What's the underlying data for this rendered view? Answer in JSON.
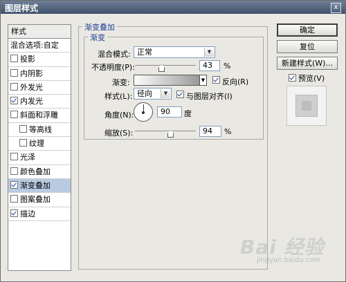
{
  "window": {
    "title": "图层样式",
    "close_glyph": "x"
  },
  "left_list": {
    "header": "样式",
    "items": [
      {
        "label": "混合选项:自定",
        "checkbox": null,
        "selected": false,
        "sub": false
      },
      {
        "label": "投影",
        "checkbox": false,
        "selected": false,
        "sub": false
      },
      {
        "label": "内阴影",
        "checkbox": false,
        "selected": false,
        "sub": false
      },
      {
        "label": "外发光",
        "checkbox": false,
        "selected": false,
        "sub": false
      },
      {
        "label": "内发光",
        "checkbox": true,
        "selected": false,
        "sub": false
      },
      {
        "label": "斜面和浮雕",
        "checkbox": false,
        "selected": false,
        "sub": false
      },
      {
        "label": "等高线",
        "checkbox": false,
        "selected": false,
        "sub": true
      },
      {
        "label": "纹理",
        "checkbox": false,
        "selected": false,
        "sub": true
      },
      {
        "label": "光泽",
        "checkbox": false,
        "selected": false,
        "sub": false
      },
      {
        "label": "颜色叠加",
        "checkbox": false,
        "selected": false,
        "sub": false
      },
      {
        "label": "渐变叠加",
        "checkbox": true,
        "selected": true,
        "sub": false
      },
      {
        "label": "图案叠加",
        "checkbox": false,
        "selected": false,
        "sub": false
      },
      {
        "label": "描边",
        "checkbox": true,
        "selected": false,
        "sub": false
      }
    ]
  },
  "panel": {
    "outer_group": "渐变叠加",
    "inner_group": "渐变",
    "blend_mode_label": "混合模式:",
    "blend_mode_value": "正常",
    "opacity_label": "不透明度(P):",
    "opacity_value": "43",
    "opacity_unit": "%",
    "gradient_label": "渐变:",
    "reverse_label": "反向(R)",
    "reverse_checked": true,
    "style_label": "样式(L):",
    "style_value": "径向",
    "align_label": "与图层对齐(I)",
    "align_checked": true,
    "angle_label": "角度(N):",
    "angle_value": "90",
    "angle_unit": "度",
    "scale_label": "缩放(S):",
    "scale_value": "94",
    "scale_unit": "%"
  },
  "buttons": {
    "ok": "确定",
    "reset": "复位",
    "new_style": "新建样式(W)...",
    "preview_label": "预览(V)",
    "preview_checked": true
  },
  "watermark": {
    "brand": "Bai 经验",
    "url": "jingyan.baidu.com"
  }
}
